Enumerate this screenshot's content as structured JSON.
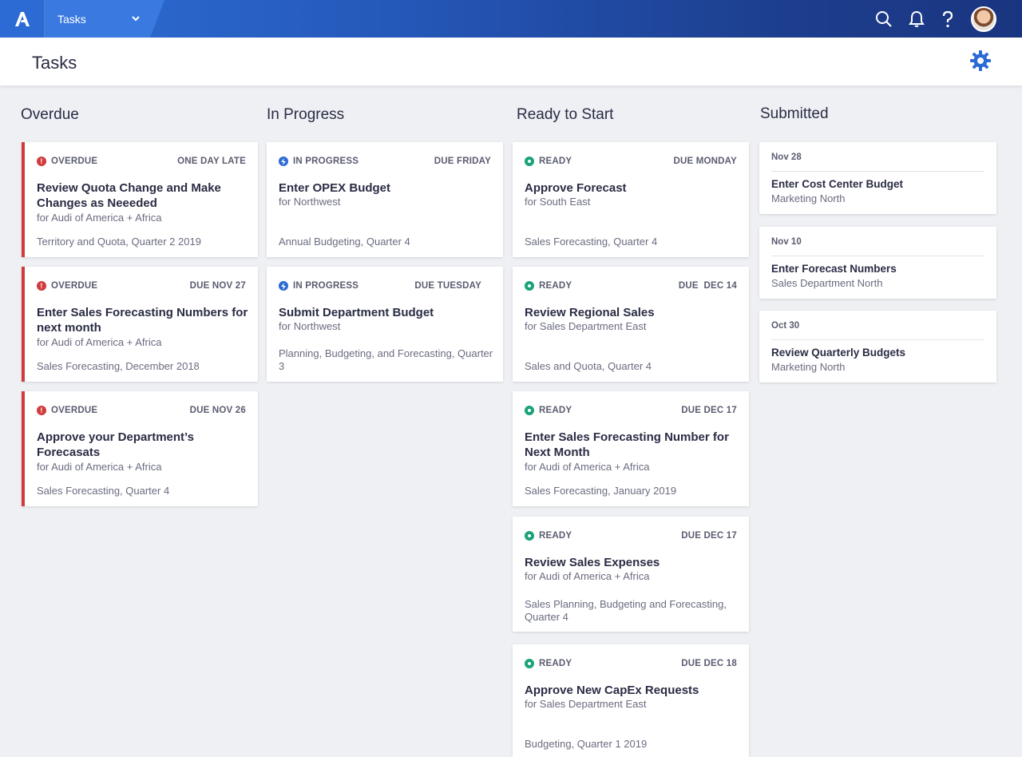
{
  "topbar": {
    "app_name": "Tasks",
    "icons": [
      "search-icon",
      "bell-icon",
      "help-icon"
    ]
  },
  "header": {
    "title": "Tasks"
  },
  "columns": {
    "overdue": "Overdue",
    "in_progress": "In Progress",
    "ready": "Ready to Start",
    "submitted": "Submitted"
  },
  "overdue_cards": [
    {
      "status": "OVERDUE",
      "due": "ONE DAY LATE",
      "title": "Review Quota Change and Make Changes as Neeeded",
      "sub": "for Audi of America + Africa",
      "foot": "Territory and Quota, Quarter 2 2019"
    },
    {
      "status": "OVERDUE",
      "due": "DUE NOV 27",
      "title": "Enter Sales Forecasting Numbers for next month",
      "sub": "for Audi of America + Africa",
      "foot": "Sales Forecasting, December 2018"
    },
    {
      "status": "OVERDUE",
      "due": "DUE NOV 26",
      "title": "Approve your Department’s Forecasats",
      "sub": "for Audi of America + Africa",
      "foot": "Sales Forecasting, Quarter 4"
    }
  ],
  "progress_cards": [
    {
      "status": "IN PROGRESS",
      "due": "DUE FRIDAY",
      "title": "Enter OPEX Budget",
      "sub": "for Northwest",
      "foot": "Annual Budgeting, Quarter 4"
    },
    {
      "status": "IN PROGRESS",
      "due": "DUE TUESDAY",
      "title": "Submit Department Budget",
      "sub": "for Northwest",
      "foot": "Planning, Budgeting, and Forecasting, Quarter 3"
    }
  ],
  "ready_cards": [
    {
      "status": "READY",
      "due": "DUE MONDAY",
      "title": "Approve Forecast",
      "sub": "for South East",
      "foot": "Sales Forecasting, Quarter 4"
    },
    {
      "status": "READY",
      "due": "DUE  DEC 14",
      "title": "Review Regional Sales",
      "sub": "for Sales Department East",
      "foot": "Sales and Quota, Quarter 4"
    },
    {
      "status": "READY",
      "due": "DUE DEC 17",
      "title": "Enter Sales Forecasting Number for Next Month",
      "sub": "for Audi of America + Africa",
      "foot": "Sales Forecasting, January 2019"
    },
    {
      "status": "READY",
      "due": "DUE DEC 17",
      "title": "Review Sales Expenses",
      "sub": "for Audi of America + Africa",
      "foot": "Sales Planning, Budgeting and Forecasting, Quarter 4"
    },
    {
      "status": "READY",
      "due": "DUE DEC 18",
      "title": "Approve New CapEx Requests",
      "sub": "for Sales Department East",
      "foot": "Budgeting, Quarter 1 2019"
    }
  ],
  "submitted_cards": [
    {
      "date": "Nov 28",
      "title": "Enter Cost Center Budget",
      "org": "Marketing North"
    },
    {
      "date": "Nov 10",
      "title": "Enter Forecast Numbers",
      "org": "Sales Department North"
    },
    {
      "date": "Oct 30",
      "title": "Review Quarterly Budgets",
      "org": "Marketing North"
    }
  ],
  "colors": {
    "overdue": "#d23b3b",
    "progress": "#2c6ad4",
    "ready": "#1aa37a",
    "accent": "#2c6ad4"
  }
}
